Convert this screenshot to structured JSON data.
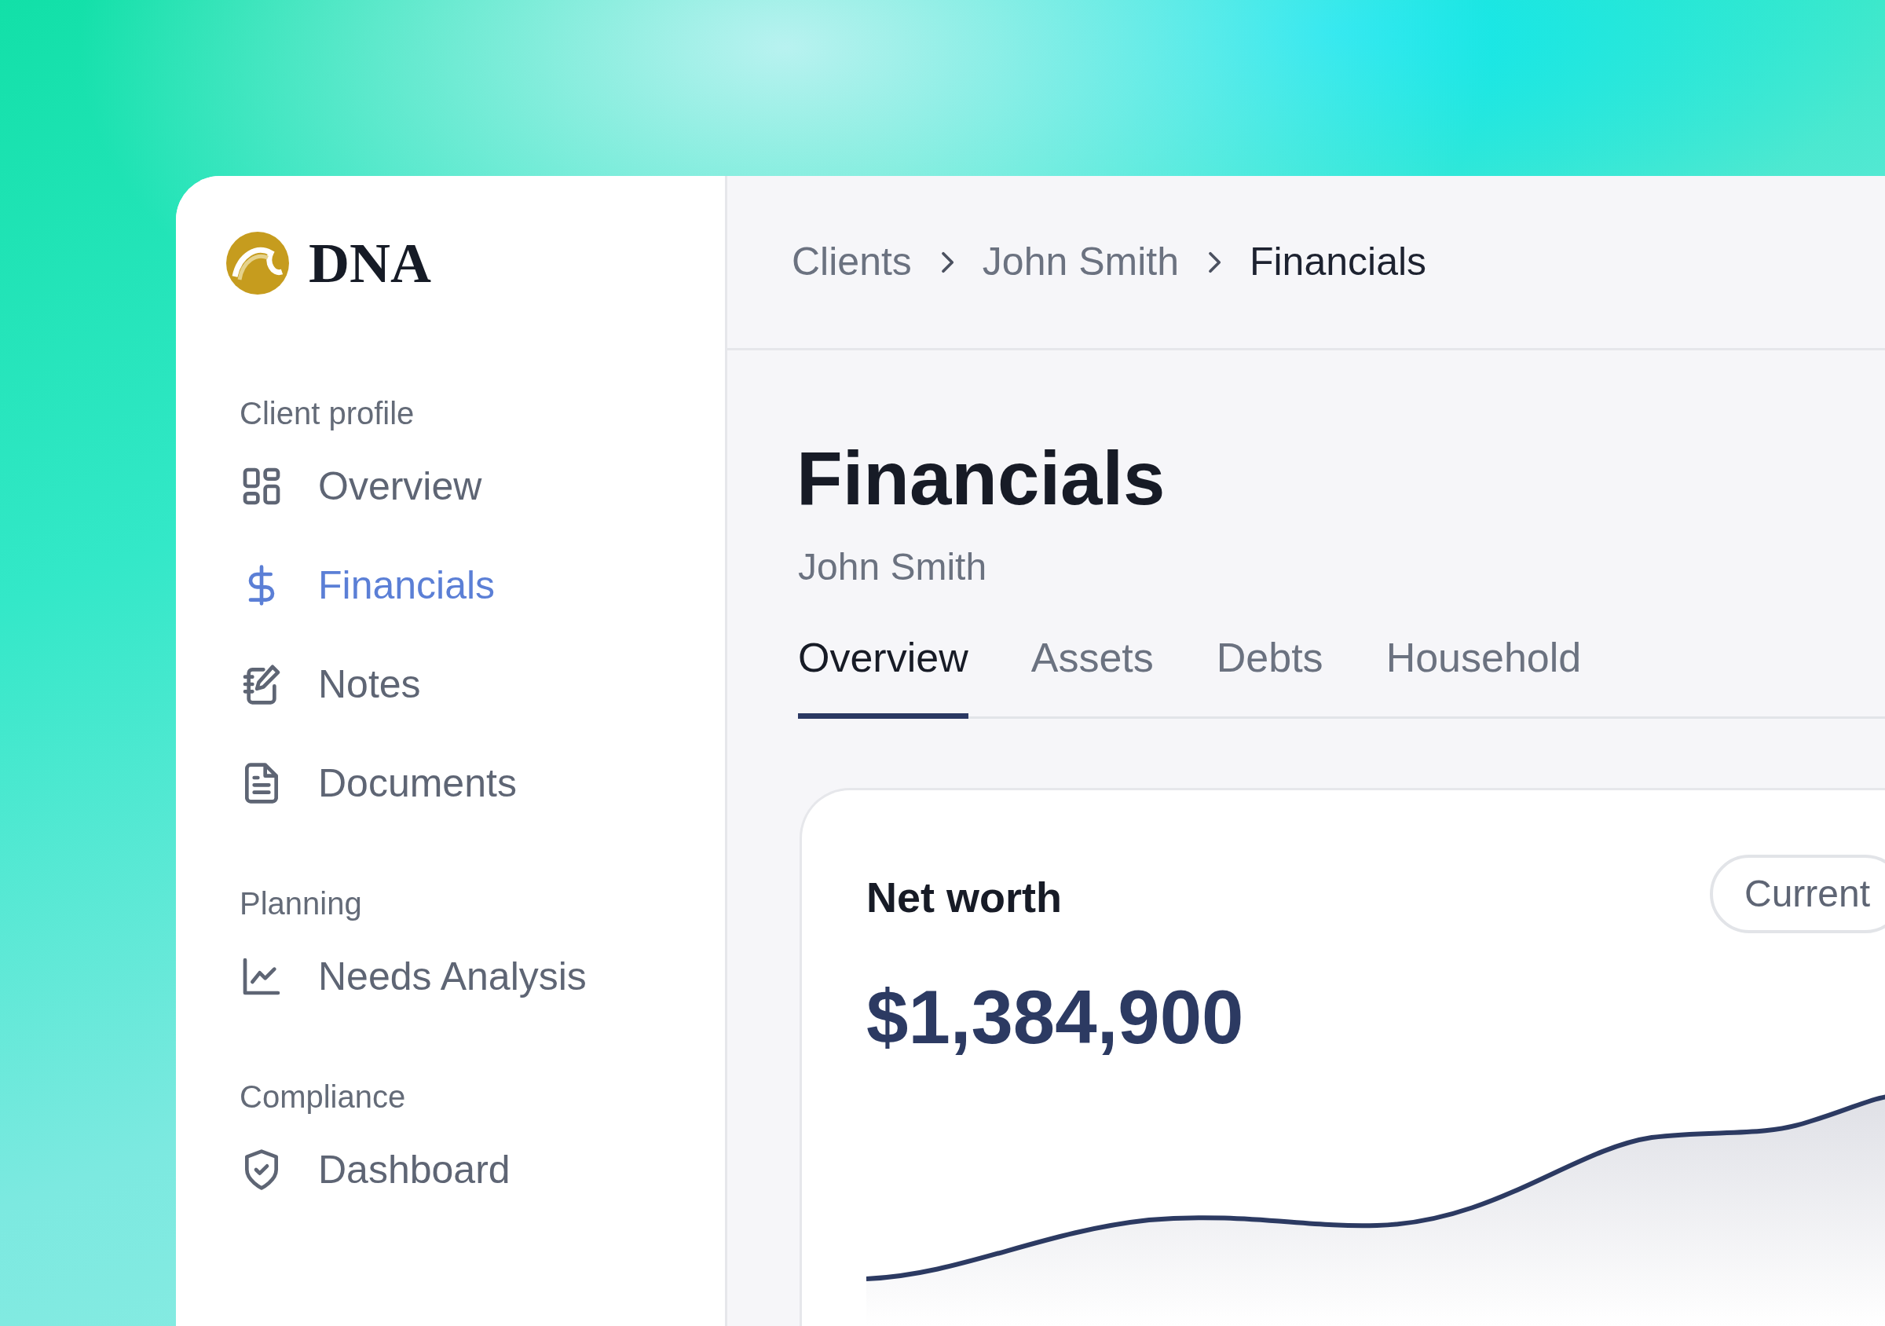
{
  "logo": {
    "text": "DNA"
  },
  "sidebar": {
    "sections": [
      {
        "title": "Client profile",
        "items": [
          {
            "label": "Overview",
            "selected": false
          },
          {
            "label": "Financials",
            "selected": true
          },
          {
            "label": "Notes",
            "selected": false
          },
          {
            "label": "Documents",
            "selected": false
          }
        ]
      },
      {
        "title": "Planning",
        "items": [
          {
            "label": "Needs Analysis",
            "selected": false
          }
        ]
      },
      {
        "title": "Compliance",
        "items": [
          {
            "label": "Dashboard",
            "selected": false
          }
        ]
      }
    ]
  },
  "breadcrumb": [
    {
      "label": "Clients",
      "current": false
    },
    {
      "label": "John Smith",
      "current": false
    },
    {
      "label": "Financials",
      "current": true
    }
  ],
  "page": {
    "title": "Financials",
    "subtitle": "John Smith"
  },
  "tabs": [
    {
      "label": "Overview",
      "selected": true
    },
    {
      "label": "Assets",
      "selected": false
    },
    {
      "label": "Debts",
      "selected": false
    },
    {
      "label": "Household",
      "selected": false
    }
  ],
  "card": {
    "title": "Net worth",
    "value": "$1,384,900",
    "range_button": "Current"
  }
}
